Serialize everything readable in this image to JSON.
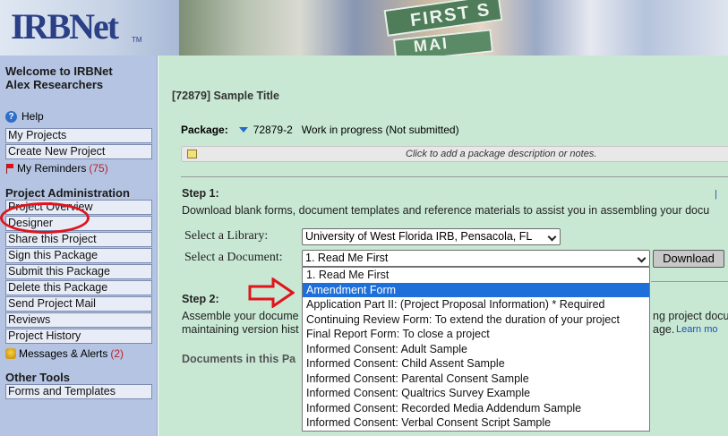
{
  "brand": {
    "logo": "IRBNet",
    "tm": "TM"
  },
  "banner": {
    "sign1": "FIRST S",
    "sign2": "MAI"
  },
  "sidebar": {
    "welcome_line1": "Welcome to IRBNet",
    "welcome_line2": "Alex Researchers",
    "help": "Help",
    "my_projects": "My Projects",
    "create_project": "Create New Project",
    "reminders_label": "My Reminders",
    "reminders_count": "(75)",
    "project_admin_title": "Project Administration",
    "admin_items": [
      "Project Overview",
      "Designer",
      "Share this Project",
      "Sign this Package",
      "Submit this Package",
      "Delete this Package",
      "Send Project Mail",
      "Reviews",
      "Project History"
    ],
    "alerts_label": "Messages & Alerts",
    "alerts_count": "(2)",
    "other_tools_title": "Other Tools",
    "forms_templates": "Forms and Templates"
  },
  "main": {
    "page_title": "[72879] Sample Title",
    "package_label": "Package:",
    "package_id": "72879-2",
    "package_status": "Work in progress (Not submitted)",
    "note_placeholder": "Click to add a package description or notes.",
    "step1_title": "Step 1:",
    "step1_text": "Download blank forms, document templates and reference materials to assist you in assembling your docu",
    "step1_help": "|",
    "library_label": "Select a Library:",
    "library_value": "University of West Florida IRB, Pensacola, FL",
    "document_label": "Select a Document:",
    "document_value": "1. Read Me First",
    "download_button": "Download",
    "step2_title": "Step 2:",
    "step2_text_line1_left": "Assemble your docume",
    "step2_text_line1_right": "ng project docu",
    "step2_text_line2_left": "maintaining version hist",
    "step2_text_line2_right": "age.",
    "step2_help": "Learn mo",
    "docs_title": "Documents in this Pa"
  },
  "dropdown_options": [
    "1. Read Me First",
    "Amendment Form",
    "Application Part II: (Project Proposal Information) * Required",
    "Continuing Review Form: To extend the duration of your project",
    "Final Report Form: To close a project",
    "Informed Consent: Adult Sample",
    "Informed Consent: Child Assent Sample",
    "Informed Consent: Parental Consent Sample",
    "Informed Consent: Qualtrics Survey Example",
    "Informed Consent: Recorded Media Addendum Sample",
    "Informed Consent: Verbal Consent Script Sample"
  ],
  "dropdown_selected_index": 1,
  "colors": {
    "sidebar_bg": "#b4c4e2",
    "main_bg": "#c8e8d4",
    "highlight": "#1e6fd9",
    "annotation_red": "#e0141c"
  }
}
